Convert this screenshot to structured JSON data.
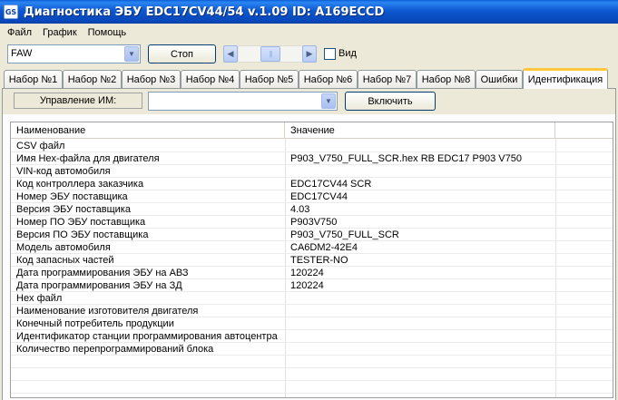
{
  "window": {
    "title": "Диагностика ЭБУ EDC17CV44/54 v.1.09 ID: A169ECCD",
    "icon": "app-icon"
  },
  "menu": [
    "Файл",
    "График",
    "Помощь"
  ],
  "toolbar": {
    "brand_value": "FAW",
    "stop_label": "Стоп",
    "view_label": "Вид",
    "view_checked": false
  },
  "tabs": [
    {
      "label": "Набор №1",
      "active": false
    },
    {
      "label": "Набор №2",
      "active": false
    },
    {
      "label": "Набор №3",
      "active": false
    },
    {
      "label": "Набор №4",
      "active": false
    },
    {
      "label": "Набор №5",
      "active": false
    },
    {
      "label": "Набор №6",
      "active": false
    },
    {
      "label": "Набор №7",
      "active": false
    },
    {
      "label": "Набор №8",
      "active": false
    },
    {
      "label": "Ошибки",
      "active": false
    },
    {
      "label": "Идентификация",
      "active": true
    }
  ],
  "control": {
    "im_label": "Управление ИМ:",
    "im_value": "",
    "enable_label": "Включить"
  },
  "grid": {
    "columns": [
      "Наименование",
      "Значение"
    ],
    "rows": [
      [
        "CSV файл",
        ""
      ],
      [
        "Имя Hex-файла для двигателя",
        "P903_V750_FULL_SCR.hex RB EDC17 P903 V750"
      ],
      [
        "VIN-код автомобиля",
        ""
      ],
      [
        "Код контроллера заказчика",
        "EDC17CV44 SCR"
      ],
      [
        "Номер ЭБУ поставщика",
        "EDC17CV44"
      ],
      [
        "Версия ЭБУ поставщика",
        "4.03"
      ],
      [
        "Номер ПО ЭБУ поставщика",
        "P903V750"
      ],
      [
        "Версия ПО ЭБУ поставщика",
        "P903_V750_FULL_SCR"
      ],
      [
        "Модель автомобиля",
        "CA6DM2-42E4"
      ],
      [
        "Код запасных частей",
        "TESTER-NO"
      ],
      [
        "Дата программирования ЭБУ на АВЗ",
        "120224"
      ],
      [
        "Дата программирования ЭБУ на ЗД",
        "120224"
      ],
      [
        "Hex файл",
        ""
      ],
      [
        "Наименование изготовителя двигателя",
        ""
      ],
      [
        "Конечный потребитель продукции",
        ""
      ],
      [
        "Идентификатор станции программирования автоцентра",
        ""
      ],
      [
        "Количество перепрограммирований блока",
        ""
      ]
    ]
  }
}
